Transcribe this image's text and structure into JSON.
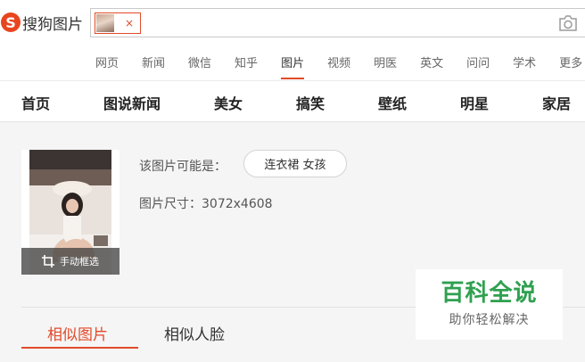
{
  "header": {
    "logo_letter": "S",
    "logo_text": "搜狗图片",
    "chip_close": "×",
    "camera_icon": "camera-icon"
  },
  "nav": {
    "items": [
      "网页",
      "新闻",
      "微信",
      "知乎",
      "图片",
      "视频",
      "明医",
      "英文",
      "问问",
      "学术",
      "更多"
    ],
    "active": "图片"
  },
  "categories": [
    "首页",
    "图说新闻",
    "美女",
    "搞笑",
    "壁纸",
    "明星",
    "家居"
  ],
  "result": {
    "crop_label": "手动框选",
    "maybe_label": "该图片可能是：",
    "tag": "连衣裙 女孩",
    "size_line": "图片尺寸：3072x4608"
  },
  "tabs": {
    "similar": "相似图片",
    "face": "相似人脸"
  },
  "watermark": {
    "title": "百科全说",
    "subtitle": "助你轻松解决"
  },
  "colors": {
    "accent": "#e24a2a",
    "watermark_green": "#2fa050"
  }
}
